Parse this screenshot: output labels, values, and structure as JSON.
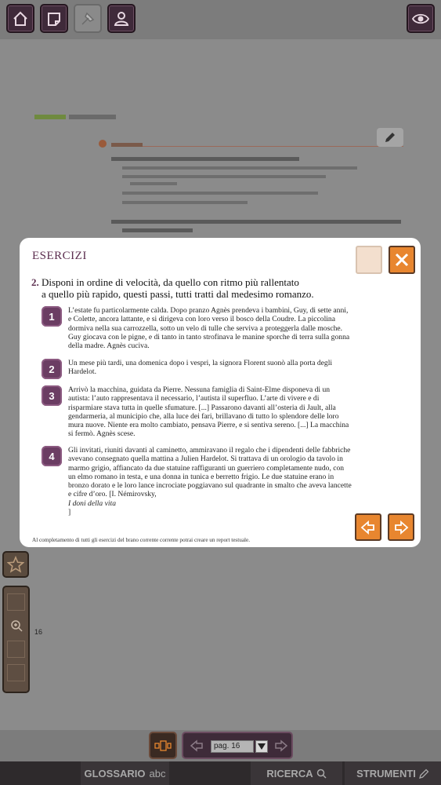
{
  "toolbar": {
    "home_icon": "home-icon",
    "bookmark_icon": "bookmark-icon",
    "tools_icon": "tools-icon",
    "user_icon": "user-icon",
    "eye_icon": "eye-icon"
  },
  "modal": {
    "title": "ESERCIZI",
    "question_number": "2.",
    "question_line1": "Disponi in ordine di velocità, da quello con ritmo più rallentato",
    "question_line2": "a quello più rapido, questi passi, tutti tratti dal medesimo romanzo.",
    "items": [
      {
        "badge": "1",
        "lines": [
          "L’estate fu particolarmente calda. Dopo pranzo Agnès prendeva i bambini, Guy, di sette anni,",
          "e Colette, ancora lattante, e si dirigeva con loro verso il bosco della Coudre. La piccolina",
          "dormiva nella sua carrozzella, sotto un velo di tulle che serviva a proteggerla dalle mosche.",
          "Guy giocava con le pigne, e di tanto in tanto strofinava le manine sporche di terra sulla gonna",
          "della madre. Agnès cuciva."
        ]
      },
      {
        "badge": "2",
        "lines": [
          "Un mese più tardi, una domenica dopo i vespri, la signora Florent suonò alla porta degli",
          "Hardelot."
        ]
      },
      {
        "badge": "3",
        "lines": [
          "Arrivò la macchina, guidata da Pierre. Nessuna famiglia di Saint-Elme disponeva di un",
          "autista: l’auto rappresentava il necessario, l’autista il superfluo. L’arte di vivere e di",
          "risparmiare stava tutta in quelle sfumature. [...] Passarono davanti all’osteria di Jault, alla",
          "gendarmeria, al municipio che, alla luce dei fari, brillavano di tutto lo splendore delle loro",
          "mura nuove. Niente era molto cambiato, pensava Pierre, e si sentiva sereno. [...] La macchina",
          "si fermò. Agnès scese."
        ]
      },
      {
        "badge": "4",
        "lines": [
          "Gli invitati, riuniti davanti al caminetto, ammiravano il regalo che i dipendenti delle fabbriche",
          "avevano consegnato quella mattina a Julien Hardelot. Si trattava di un orologio da tavolo in",
          "marmo grigio, affiancato da due statuine raffiguranti un guerriero completamente nudo, con",
          "un elmo romano in testa, e una donna in tunica e berretto frigio. Le due statuine erano in",
          "bronzo dorato e le loro lance incrociate poggiavano sul quadrante in smalto che aveva lancette"
        ],
        "last_line_plain": "e cifre d’oro. [I. Némirovsky, ",
        "last_line_italic": "I doni della vita",
        "last_line_end": "]"
      }
    ],
    "footnote": "Al completamento di tutti gli esercizi del brano corrente corrente potrai creare un report testuale.",
    "close_icon": "close-icon",
    "prev_icon": "arrow-left-icon",
    "next_icon": "arrow-right-icon"
  },
  "sidebar": {
    "page_number": "16",
    "star_icon": "star-icon",
    "zoom_icon": "zoom-in-icon"
  },
  "pager": {
    "page_value": "pag. 16",
    "dropdown_icon": "caret-down-icon"
  },
  "tabs": {
    "glossario": "GLOSSARIO",
    "glossario_symbol": "abc",
    "ricerca": "RICERCA",
    "strumenti": "STRUMENTI"
  },
  "colors": {
    "accent_orange": "#e8862f",
    "badge_purple": "#6b3d63",
    "toolbar_dark": "#3f2a3a"
  }
}
